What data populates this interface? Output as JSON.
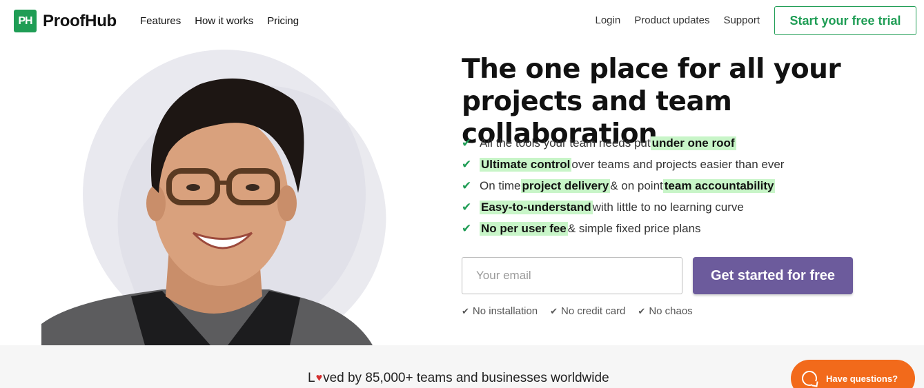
{
  "brand": {
    "logo_mark": "PH",
    "name": "ProofHub",
    "accent_color": "#1f9d55",
    "cta_color": "#6c5b9c",
    "chat_color": "#f26a1b"
  },
  "nav": {
    "left": [
      "Features",
      "How it works",
      "Pricing"
    ],
    "right": [
      "Login",
      "Product updates",
      "Support"
    ],
    "trial_button": "Start your free trial"
  },
  "hero": {
    "headline": "The one place for all your projects and team collaboration",
    "features": [
      {
        "before": "All the tools your team needs put ",
        "highlight": "under one roof",
        "after": "",
        "highlight2": "",
        "after2": ""
      },
      {
        "before": "",
        "highlight": "Ultimate control",
        "after": " over teams and projects easier than ever",
        "highlight2": "",
        "after2": ""
      },
      {
        "before": "On time ",
        "highlight": "project delivery",
        "after": " & on point ",
        "highlight2": "team accountability",
        "after2": ""
      },
      {
        "before": "",
        "highlight": "Easy-to-understand",
        "after": " with little to no learning curve",
        "highlight2": "",
        "after2": ""
      },
      {
        "before": "",
        "highlight": "No per user fee",
        "after": " & simple fixed price plans",
        "highlight2": "",
        "after2": ""
      }
    ],
    "email_placeholder": "Your email",
    "cta_label": "Get started for free",
    "perks": [
      "No installation",
      "No credit card",
      "No chaos"
    ]
  },
  "band": {
    "loved_prefix": "L",
    "loved_suffix": "ved by 85,000+ teams and businesses worldwide"
  },
  "chat": {
    "label": "Have questions?"
  }
}
